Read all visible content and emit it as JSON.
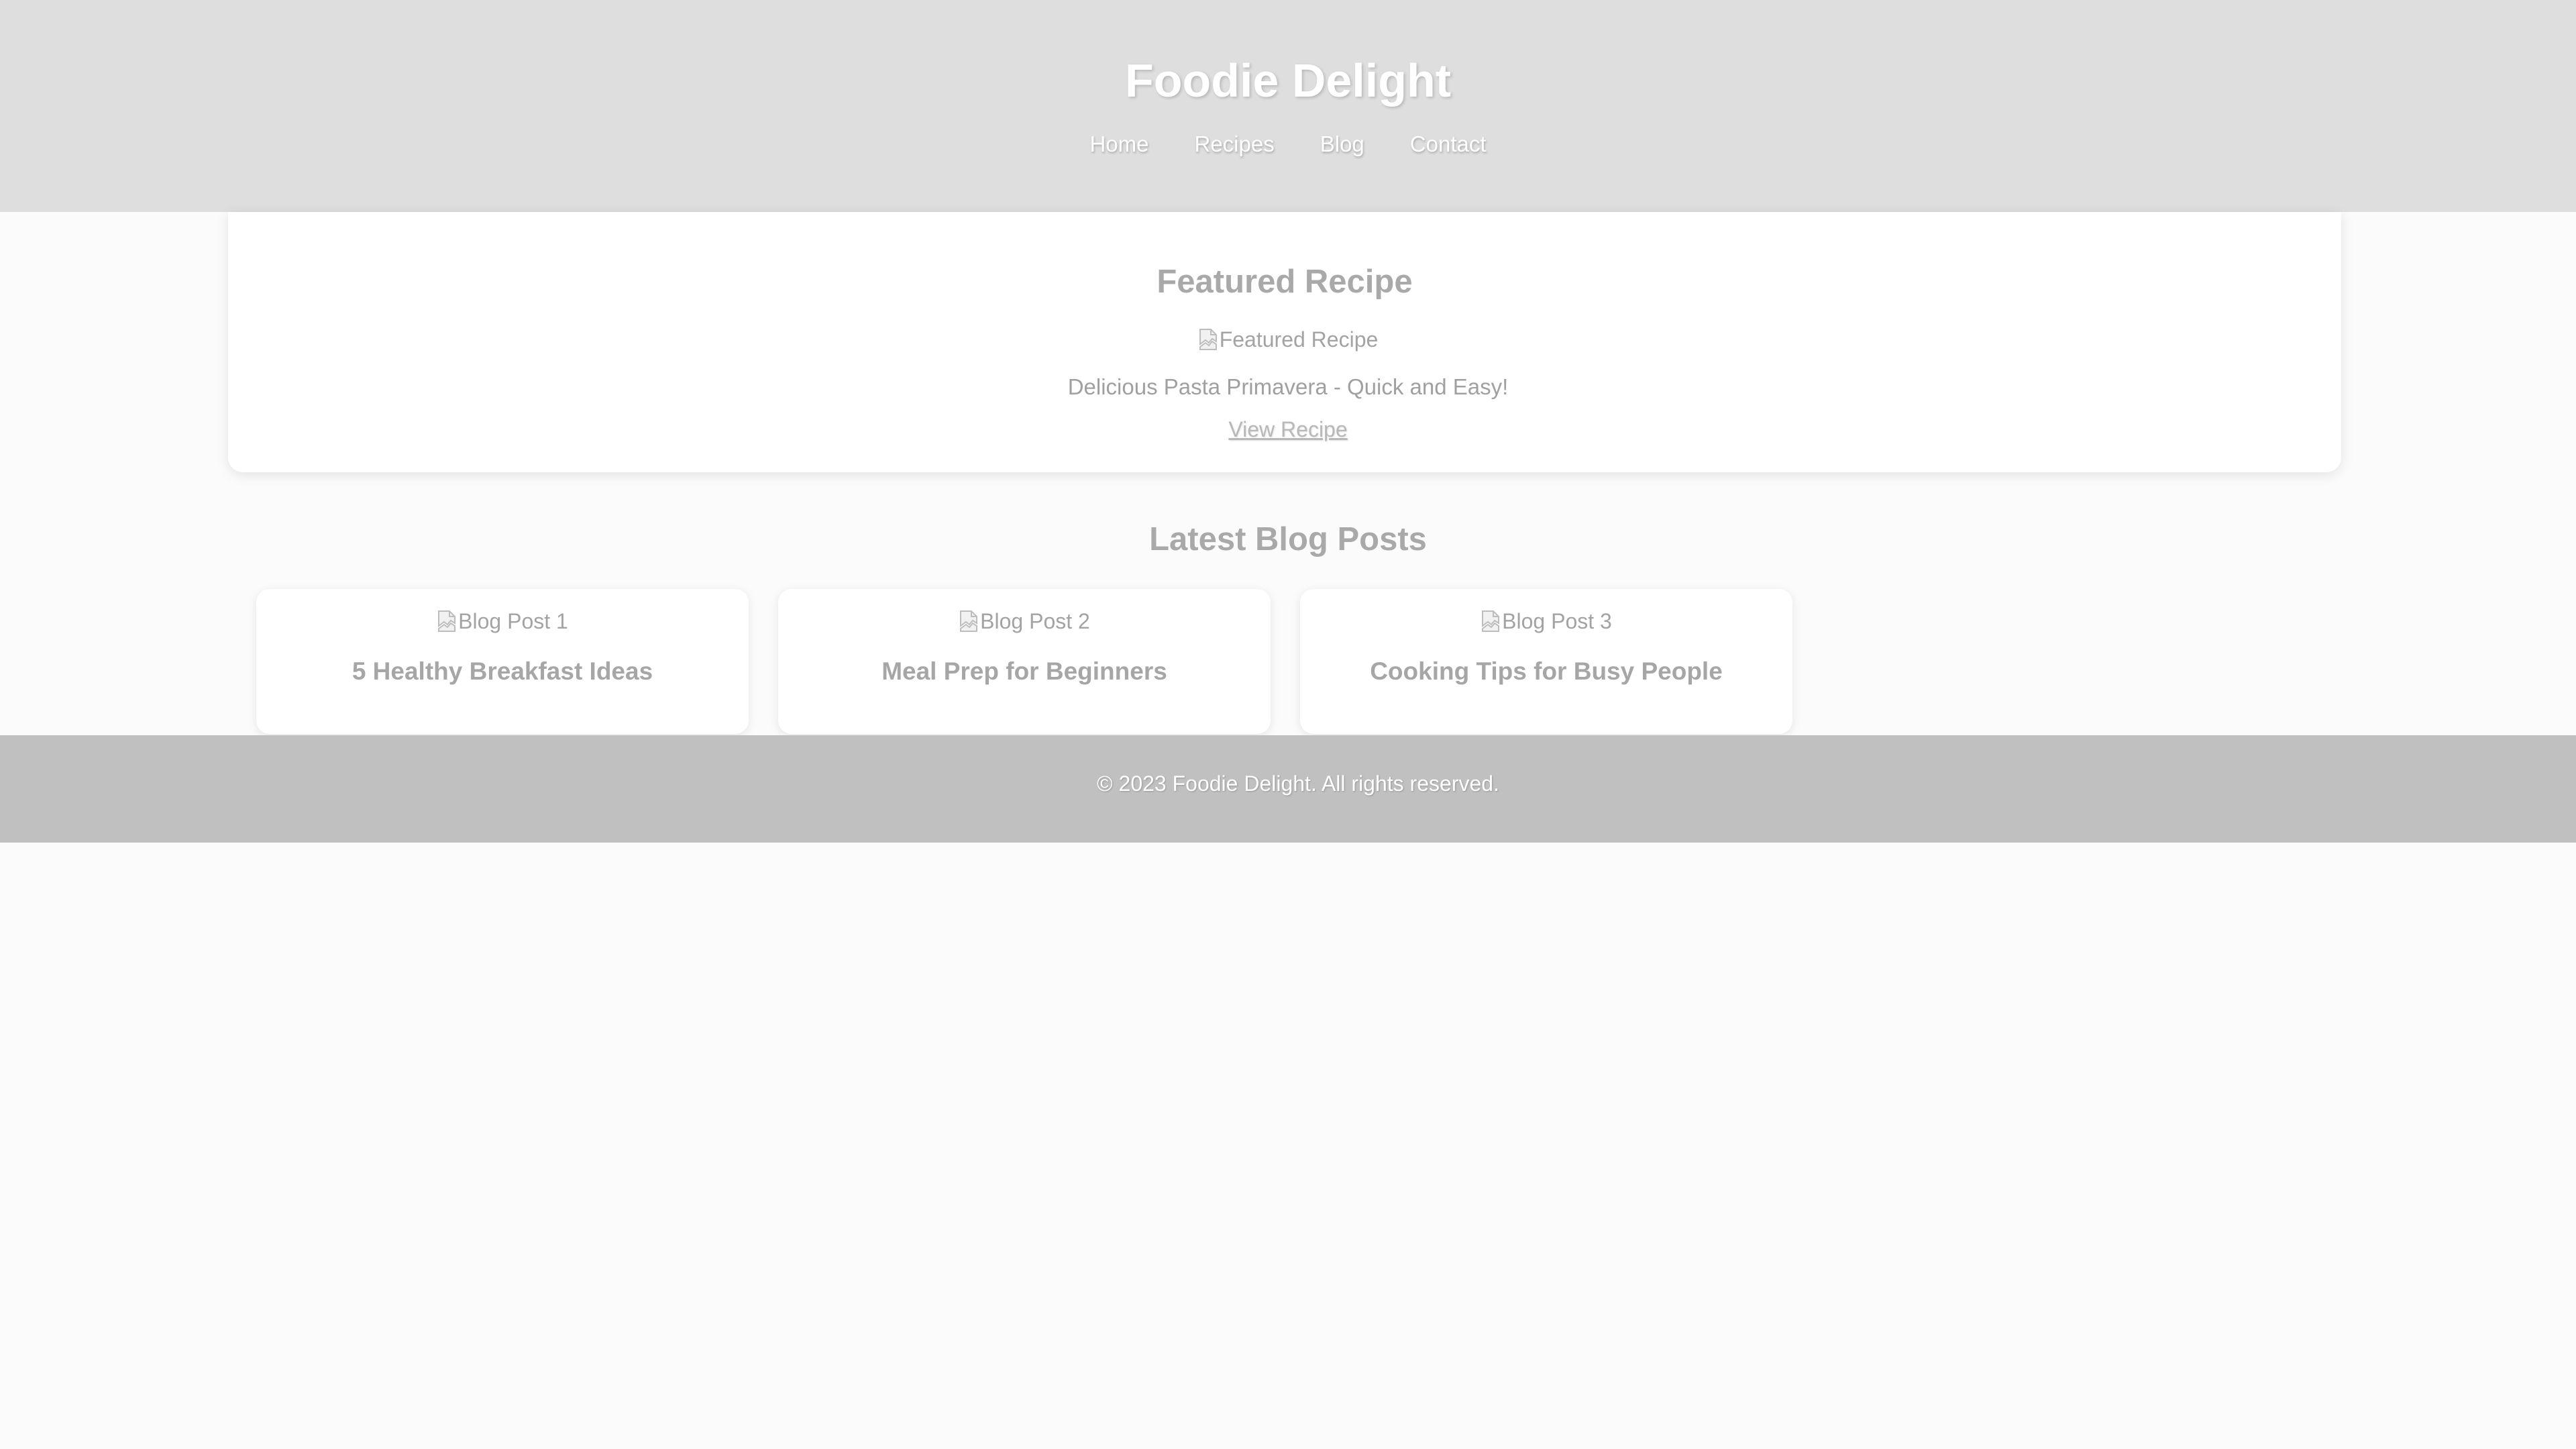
{
  "header": {
    "title": "Foodie Delight",
    "nav": [
      "Home",
      "Recipes",
      "Blog",
      "Contact"
    ]
  },
  "featured": {
    "heading": "Featured Recipe",
    "image_alt": "Featured Recipe",
    "description": "Delicious Pasta Primavera - Quick and Easy!",
    "link_label": "View Recipe"
  },
  "blog": {
    "heading": "Latest Blog Posts",
    "posts": [
      {
        "image_alt": "Blog Post 1",
        "title": "5 Healthy Breakfast Ideas"
      },
      {
        "image_alt": "Blog Post 2",
        "title": "Meal Prep for Beginners"
      },
      {
        "image_alt": "Blog Post 3",
        "title": "Cooking Tips for Busy People"
      }
    ]
  },
  "footer": {
    "text": "© 2023 Foodie Delight. All rights reserved."
  },
  "icons": {
    "broken_image": "broken-image-icon"
  },
  "colors": {
    "header_bg": "#dedede",
    "footer_bg": "#c0c0c0",
    "page_bg": "#fbfbfb",
    "heading_text": "#a9a9a9"
  }
}
